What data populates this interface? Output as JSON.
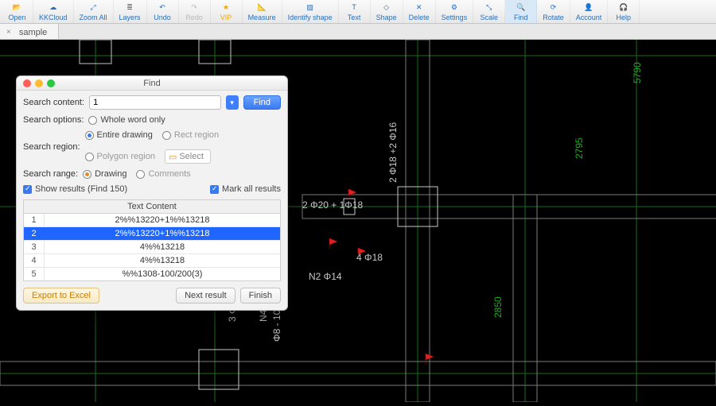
{
  "toolbar": [
    {
      "name": "open",
      "label": "Open"
    },
    {
      "name": "kkcloud",
      "label": "KKCloud"
    },
    {
      "name": "zoom-all",
      "label": "Zoom All"
    },
    {
      "name": "layers",
      "label": "Layers"
    },
    {
      "name": "undo",
      "label": "Undo"
    },
    {
      "name": "redo",
      "label": "Redo",
      "disabled": true
    },
    {
      "name": "vip",
      "label": "VIP",
      "vip": true
    },
    {
      "name": "measure",
      "label": "Measure"
    },
    {
      "name": "identify-shape",
      "label": "Identify shape"
    },
    {
      "name": "text",
      "label": "Text"
    },
    {
      "name": "shape",
      "label": "Shape"
    },
    {
      "name": "delete",
      "label": "Delete"
    },
    {
      "name": "settings",
      "label": "Settings"
    },
    {
      "name": "scale",
      "label": "Scale"
    },
    {
      "name": "find",
      "label": "Find",
      "active": true
    },
    {
      "name": "rotate",
      "label": "Rotate"
    },
    {
      "name": "account",
      "label": "Account"
    },
    {
      "name": "help",
      "label": "Help"
    }
  ],
  "tab": {
    "label": "sample"
  },
  "dialog": {
    "title": "Find",
    "search_content_label": "Search content:",
    "search_content_value": "1",
    "find_btn": "Find",
    "search_options_label": "Search options:",
    "whole_word": "Whole word only",
    "search_region_label": "Search region:",
    "regions": {
      "entire": "Entire drawing",
      "rect": "Rect region",
      "poly": "Polygon region"
    },
    "select_btn": "Select",
    "search_range_label": "Search range:",
    "ranges": {
      "drawing": "Drawing",
      "comments": "Comments"
    },
    "show_results": "Show results (Find 150)",
    "mark_all": "Mark all results",
    "grid_header": "Text Content",
    "rows": [
      {
        "n": "1",
        "v": "2%%13220+1%%13218"
      },
      {
        "n": "2",
        "v": "2%%13220+1%%13218",
        "sel": true
      },
      {
        "n": "3",
        "v": "4%%13218"
      },
      {
        "n": "4",
        "v": "4%%13218"
      },
      {
        "n": "5",
        "v": "%%1308-100/200(3)"
      }
    ],
    "export": "Export to Excel",
    "next": "Next result",
    "finish": "Finish"
  },
  "canvas_text": {
    "t1": "2 Φ20 + 1Φ18",
    "t2": "4 Φ18",
    "t3": "N2 Φ14",
    "t4": "N4 Φ12",
    "t5": "3 Φ18",
    "t6": "Φ8 - 100 ( 4 )",
    "t7": "2 Φ18 +2 Φ16",
    "d1": "5790",
    "d2": "2795",
    "d3": "2850"
  }
}
